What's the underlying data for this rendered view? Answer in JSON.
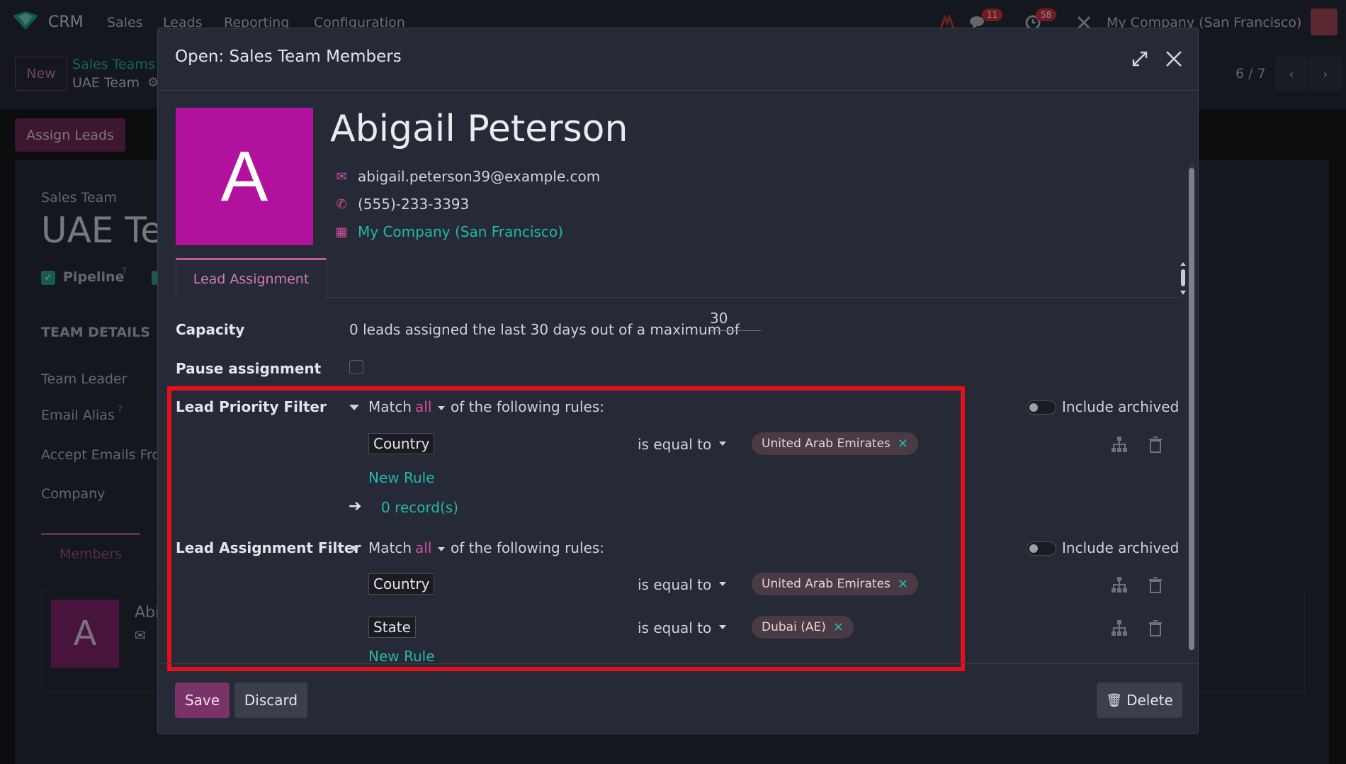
{
  "topbar": {
    "app_name": "CRM",
    "nav": [
      "Sales",
      "Leads",
      "Reporting",
      "Configuration"
    ],
    "messages_badge": "11",
    "activities_badge": "58",
    "company": "My Company (San Francisco)"
  },
  "control_panel": {
    "new_label": "New",
    "breadcrumb_parent": "Sales Teams",
    "breadcrumb_current": "UAE Team",
    "pager": "6 / 7"
  },
  "background_form": {
    "assign_leads_label": "Assign Leads",
    "sales_team_label": "Sales Team",
    "title": "UAE Te",
    "pipeline_label": "Pipeline",
    "help_mark": "?",
    "team_details_heading": "TEAM DETAILS",
    "fields": [
      "Team Leader",
      "Email Alias",
      "Accept Emails Fro",
      "Company"
    ],
    "members_tab": "Members",
    "member_avatar_letter": "A",
    "member_name": "Abi"
  },
  "modal": {
    "title": "Open: Sales Team Members",
    "profile": {
      "avatar_letter": "A",
      "name": "Abigail Peterson",
      "email": "abigail.peterson39@example.com",
      "phone": "(555)-233-3393",
      "company": "My Company (San Francisco)"
    },
    "tab_label": "Lead Assignment",
    "capacity": {
      "label": "Capacity",
      "text": "0 leads assigned the last 30 days out of a maximum of",
      "value": "30"
    },
    "pause": {
      "label": "Pause assignment",
      "checked": false
    },
    "priority_filter": {
      "label": "Lead Priority Filter",
      "match_prefix": "Match",
      "match_mode": "all",
      "match_suffix": "of the following rules:",
      "include_archived": "Include archived",
      "rules": [
        {
          "field": "Country",
          "operator": "is equal to",
          "value": "United Arab Emirates"
        }
      ],
      "new_rule": "New Rule",
      "records": "0 record(s)"
    },
    "assignment_filter": {
      "label": "Lead Assignment Filter",
      "match_prefix": "Match",
      "match_mode": "all",
      "match_suffix": "of the following rules:",
      "include_archived": "Include archived",
      "rules": [
        {
          "field": "Country",
          "operator": "is equal to",
          "value": "United Arab Emirates"
        },
        {
          "field": "State",
          "operator": "is equal to",
          "value": "Dubai (AE)"
        }
      ],
      "new_rule": "New Rule"
    },
    "footer": {
      "save": "Save",
      "discard": "Discard",
      "delete": "Delete"
    }
  },
  "colors": {
    "accent": "#d14fa0",
    "link": "#22b8a8",
    "highlight": "#e3101a",
    "avatar": "#b0129e"
  }
}
